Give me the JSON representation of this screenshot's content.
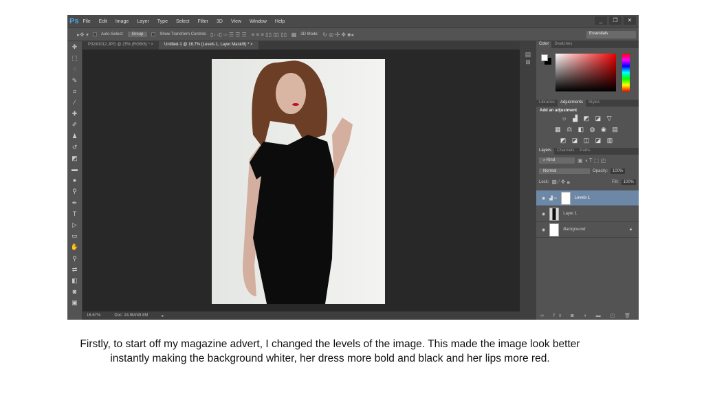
{
  "app": {
    "logo": "Ps",
    "menu": [
      "File",
      "Edit",
      "Image",
      "Layer",
      "Type",
      "Select",
      "Filter",
      "3D",
      "View",
      "Window",
      "Help"
    ],
    "window_buttons": [
      "_",
      "❐",
      "✕"
    ]
  },
  "options": {
    "auto_select": "Auto-Select:",
    "group": "Group",
    "show_transform": "Show Transform Controls",
    "mode3d": "3D Mode:",
    "workspace": "Essentials"
  },
  "doc_tabs": [
    {
      "label": "P3240012.JPG @ 25% (RGB/8) *",
      "close": "×"
    },
    {
      "label": "Untitled-1 @ 16.7% (Levels 1, Layer Mask/8) *",
      "close": "×"
    }
  ],
  "status": {
    "zoom": "16.67%",
    "doc": "Doc: 24.9M/49.8M"
  },
  "color_panel": {
    "tabs": [
      "Color",
      "Swatches"
    ]
  },
  "adjust_panel": {
    "tabs": [
      "Libraries",
      "Adjustments",
      "Styles"
    ],
    "heading": "Add an adjustment"
  },
  "layers_panel": {
    "tabs": [
      "Layers",
      "Channels",
      "Paths"
    ],
    "filter": "Kind",
    "blend": "Normal",
    "opacity_label": "Opacity:",
    "opacity": "100%",
    "lock_label": "Lock:",
    "fill_label": "Fill:",
    "fill": "100%",
    "layers": [
      {
        "name": "Levels 1"
      },
      {
        "name": "Layer 1"
      },
      {
        "name": "Background"
      }
    ]
  },
  "caption": "Firstly, to start off my magazine advert, I changed the levels of the image. This made the image look better instantly making the background whiter, her dress more bold and black and her lips more red."
}
